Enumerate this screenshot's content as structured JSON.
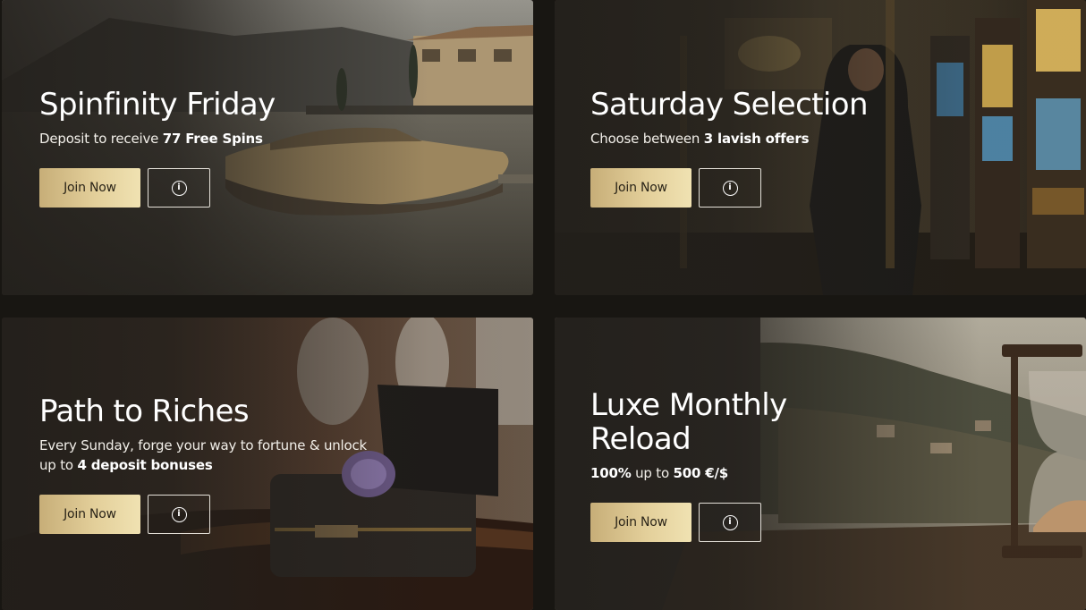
{
  "cards": [
    {
      "title": "Spinfinity Friday",
      "sub_text": "Deposit to receive ",
      "sub_bold": "77 Free Spins",
      "join_label": "Join Now",
      "info_icon": "info-icon"
    },
    {
      "title": "Saturday Selection",
      "sub_text": "Choose between ",
      "sub_bold": "3 lavish offers",
      "join_label": "Join Now",
      "info_icon": "info-icon"
    },
    {
      "title": "Path to Riches",
      "sub_line1": "Every Sunday, forge your way to fortune & unlock",
      "sub_text": "up to ",
      "sub_bold": "4 deposit bonuses",
      "join_label": "Join Now",
      "info_icon": "info-icon"
    },
    {
      "title_line1": "Luxe Monthly",
      "title_line2": "Reload",
      "sub_bold1": "100%",
      "sub_text": " up to ",
      "sub_bold2": "500 €/$",
      "join_label": "Join Now",
      "info_icon": "info-icon"
    }
  ],
  "info_glyph": "i",
  "colors": {
    "page_bg": "#181612",
    "card_overlay": "#221f1b",
    "gold_gradient_start": "#c7ae78",
    "gold_gradient_end": "#f0e2b2"
  }
}
